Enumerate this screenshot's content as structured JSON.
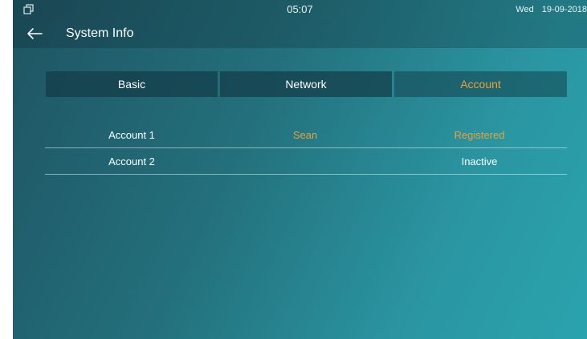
{
  "status_bar": {
    "icon": "window-restore-icon",
    "time": "05:07",
    "day": "Wed",
    "date": "19-09-2018"
  },
  "header": {
    "back_icon": "arrow-left-icon",
    "title": "System Info"
  },
  "tabs": [
    {
      "label": "Basic",
      "active": false
    },
    {
      "label": "Network",
      "active": false
    },
    {
      "label": "Account",
      "active": true
    }
  ],
  "accounts": [
    {
      "name": "Account 1",
      "user": "Sean",
      "status": "Registered"
    },
    {
      "name": "Account 2",
      "user": "",
      "status": "Inactive"
    }
  ],
  "colors": {
    "accent": "#e9a13a",
    "background_start": "#1f5462",
    "background_end": "#2aa3ae"
  }
}
